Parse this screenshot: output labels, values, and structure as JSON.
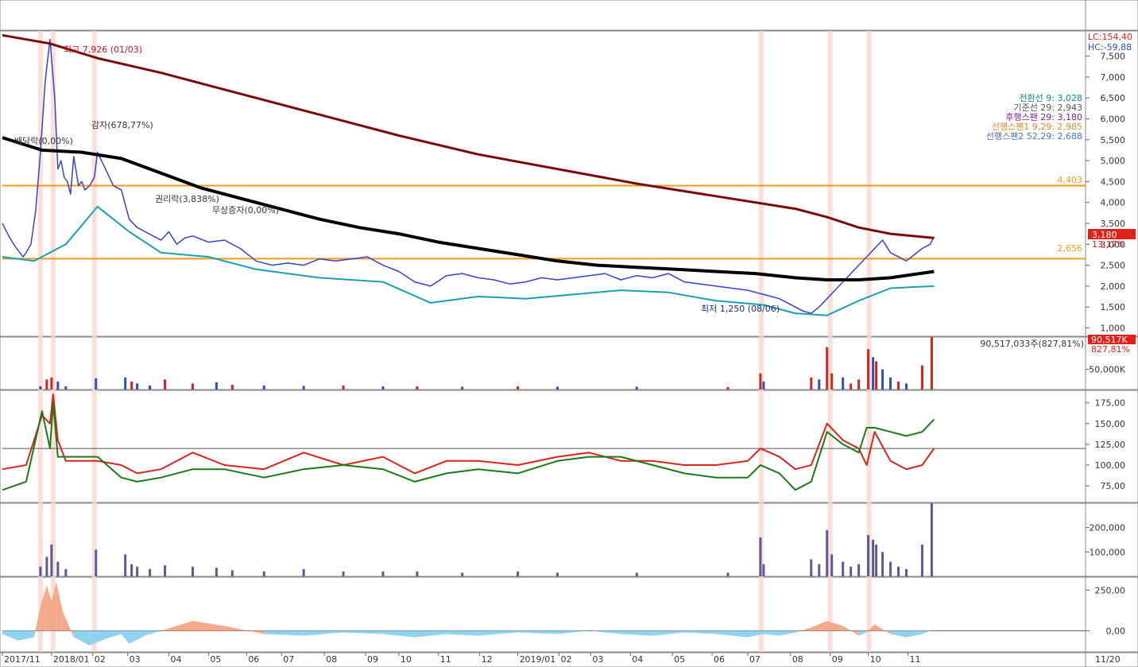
{
  "chart_data": [
    {
      "type": "line",
      "panel": "price",
      "ylim": [
        800,
        8100
      ],
      "yticks": [
        7500,
        7000,
        6500,
        6000,
        5500,
        5000,
        4500,
        4000,
        3500,
        3000,
        2500,
        2000,
        1500,
        1000
      ],
      "ytick_labels": [
        "7,500",
        "7,000",
        "6,500",
        "6,000",
        "5,500",
        "5,000",
        "4,500",
        "4,000",
        "3,500",
        "3,000",
        "2,500",
        "2,000",
        "1,500",
        "1,000"
      ],
      "corner_labels": {
        "lc": "LC:154,40",
        "hc": "HC:-59,88"
      },
      "legend": [
        {
          "text": "전환선 9: 3,028",
          "color": "#0c8a8a"
        },
        {
          "text": "기준선 29: 2,943",
          "color": "#555555"
        },
        {
          "text": "후행스팬 29: 3,180",
          "color": "#7a1f9e"
        },
        {
          "text": "선행스팬1 9,29: 2,985",
          "color": "#e28a2b"
        },
        {
          "text": "선행스팬2 52,29: 2,688",
          "color": "#4a6fd1"
        }
      ],
      "hlines": [
        {
          "value": 4403,
          "label": "4,403",
          "color": "#f59a1b"
        },
        {
          "value": 2656,
          "label": "2,656",
          "color": "#f59a1b"
        }
      ],
      "price_tag": {
        "value": 3180,
        "label": "3,180",
        "pct": "13,17%",
        "color": "#e0201b"
      },
      "annotations": [
        {
          "text": "최고 7,926 (01/03)",
          "color": "#c8102e"
        },
        {
          "text": "감자(678,77%)",
          "color": "#333333"
        },
        {
          "text": "배당락(0,00%)",
          "color": "#333333"
        },
        {
          "text": "권리락(3,838%)",
          "color": "#333333"
        },
        {
          "text": "무상증자(0,00%)",
          "color": "#333333"
        },
        {
          "text": "최저 1,250 (08/06)",
          "color": "#1a2a8a"
        }
      ],
      "series": [
        {
          "kind": "close",
          "color": "#3344cc",
          "x": [
            0,
            8,
            16,
            22,
            26,
            30,
            36,
            42,
            48,
            54,
            60,
            66,
            70,
            74,
            78,
            82,
            86,
            90,
            96,
            100,
            104,
            110,
            116,
            120,
            125,
            130,
            140,
            150,
            160,
            170,
            180,
            190,
            200,
            210,
            220,
            230,
            240,
            260,
            280,
            300,
            320,
            340,
            360,
            380,
            400,
            420,
            440,
            460,
            480,
            500,
            520,
            540,
            560,
            580,
            600,
            620,
            640,
            660,
            680,
            700,
            720,
            740,
            760,
            780,
            800,
            820,
            840,
            860,
            880,
            900,
            920,
            940,
            960,
            980,
            990,
            1000,
            1010,
            1020,
            1030,
            1040,
            1050,
            1060,
            1070,
            1080,
            1090,
            1100,
            1110,
            1120,
            1130,
            1140,
            1150,
            1160,
            1170,
            1175
          ],
          "y": [
            3500,
            3200,
            2950,
            2800,
            2700,
            2800,
            3000,
            3800,
            5200,
            6900,
            7900,
            6500,
            4800,
            5000,
            4600,
            4500,
            4200,
            5100,
            4400,
            4500,
            4300,
            4400,
            4600,
            5200,
            5000,
            4800,
            4400,
            4300,
            3600,
            3400,
            3300,
            3200,
            3100,
            3300,
            3000,
            3150,
            3200,
            3050,
            3100,
            2900,
            2600,
            2500,
            2550,
            2500,
            2650,
            2600,
            2650,
            2700,
            2500,
            2350,
            2100,
            2000,
            2250,
            2300,
            2200,
            2150,
            2050,
            2100,
            2200,
            2150,
            2200,
            2250,
            2300,
            2150,
            2250,
            2200,
            2300,
            2100,
            2050,
            2000,
            1950,
            1900,
            1800,
            1700,
            1600,
            1500,
            1400,
            1350,
            1500,
            1700,
            1900,
            2100,
            2300,
            2500,
            2700,
            2900,
            3100,
            2800,
            2700,
            2600,
            2750,
            2900,
            3000,
            3180
          ]
        },
        {
          "kind": "ma_long",
          "color": "#7a0a0a",
          "x": [
            0,
            60,
            120,
            200,
            300,
            400,
            500,
            600,
            700,
            800,
            900,
            1000,
            1040,
            1080,
            1120,
            1175
          ],
          "y": [
            8000,
            7800,
            7450,
            7100,
            6600,
            6100,
            5600,
            5150,
            4800,
            4450,
            4150,
            3850,
            3650,
            3400,
            3250,
            3150
          ]
        },
        {
          "kind": "ma_mid",
          "color": "#000000",
          "x": [
            0,
            50,
            100,
            150,
            200,
            250,
            300,
            350,
            400,
            450,
            500,
            550,
            600,
            650,
            700,
            750,
            800,
            850,
            900,
            950,
            1000,
            1040,
            1080,
            1120,
            1175
          ],
          "y": [
            5550,
            5250,
            5200,
            5050,
            4700,
            4350,
            4100,
            3850,
            3600,
            3400,
            3250,
            3050,
            2900,
            2750,
            2600,
            2500,
            2450,
            2400,
            2350,
            2300,
            2200,
            2150,
            2150,
            2200,
            2350
          ]
        },
        {
          "kind": "envelope_low",
          "color": "#1aa0b0",
          "x": [
            0,
            40,
            80,
            120,
            160,
            200,
            260,
            320,
            400,
            480,
            540,
            600,
            660,
            720,
            780,
            840,
            900,
            960,
            1000,
            1040,
            1080,
            1120,
            1175
          ],
          "y": [
            2700,
            2600,
            3000,
            3900,
            3300,
            2800,
            2700,
            2400,
            2200,
            2100,
            1600,
            1750,
            1700,
            1800,
            1900,
            1850,
            1650,
            1550,
            1350,
            1300,
            1650,
            1950,
            2000
          ]
        }
      ]
    },
    {
      "type": "bar",
      "panel": "volume",
      "ylim": [
        0,
        130000
      ],
      "ytick_labels": [
        "50,000K"
      ],
      "yticks": [
        50000
      ],
      "header": "90,517,033주(827,81%)",
      "tag": {
        "label": "90,517K",
        "pct": "827,81%"
      },
      "x": [
        48,
        56,
        62,
        70,
        80,
        118,
        155,
        163,
        170,
        186,
        205,
        240,
        270,
        290,
        330,
        380,
        430,
        480,
        523,
        580,
        650,
        700,
        800,
        915,
        956,
        960,
        1020,
        1030,
        1040,
        1046,
        1060,
        1070,
        1080,
        1092,
        1098,
        1102,
        1110,
        1120,
        1130,
        1140,
        1160,
        1172
      ],
      "values": [
        8000,
        25000,
        30000,
        20000,
        8000,
        28000,
        30000,
        20000,
        15000,
        10000,
        25000,
        15000,
        18000,
        12000,
        10000,
        9000,
        10000,
        8000,
        8000,
        7000,
        8000,
        7000,
        7000,
        6000,
        40000,
        20000,
        30000,
        25000,
        105000,
        40000,
        30000,
        15000,
        25000,
        100000,
        80000,
        70000,
        50000,
        30000,
        20000,
        15000,
        60000,
        130000
      ],
      "colors": [
        "#2a4fc8",
        "#d9231b",
        "#d9231b",
        "#2a4fc8",
        "#2a4fc8",
        "#2a4fc8",
        "#2a4fc8",
        "#d9231b",
        "#2a4fc8",
        "#2a4fc8",
        "#d9231b",
        "#d9231b",
        "#2a4fc8",
        "#d9231b",
        "#2a4fc8",
        "#2a4fc8",
        "#d9231b",
        "#2a4fc8",
        "#d9231b",
        "#2a4fc8",
        "#d9231b",
        "#2a4fc8",
        "#2a4fc8",
        "#d9231b",
        "#d9231b",
        "#2a4fc8",
        "#d9231b",
        "#2a4fc8",
        "#d9231b",
        "#d9231b",
        "#2a4fc8",
        "#d9231b",
        "#d9231b",
        "#d9231b",
        "#2a4fc8",
        "#d9231b",
        "#2a4fc8",
        "#2a4fc8",
        "#d9231b",
        "#2a4fc8",
        "#d9231b",
        "#d9231b"
      ]
    },
    {
      "type": "line",
      "panel": "oscillator",
      "ylim": [
        55,
        190
      ],
      "yticks": [
        175,
        150,
        125,
        100,
        75
      ],
      "ytick_labels": [
        "175,00",
        "150,00",
        "125,00",
        "100,00",
        "75,00"
      ],
      "baseline": 120,
      "series": [
        {
          "color": "#d9231b",
          "x": [
            0,
            30,
            50,
            60,
            64,
            70,
            80,
            100,
            120,
            150,
            170,
            200,
            240,
            280,
            330,
            380,
            430,
            480,
            520,
            560,
            600,
            650,
            700,
            740,
            780,
            820,
            860,
            900,
            940,
            956,
            980,
            1000,
            1020,
            1040,
            1060,
            1080,
            1090,
            1100,
            1120,
            1140,
            1160,
            1175
          ],
          "y": [
            95,
            100,
            160,
            150,
            185,
            130,
            105,
            105,
            105,
            100,
            90,
            95,
            115,
            100,
            95,
            115,
            100,
            110,
            90,
            105,
            105,
            100,
            110,
            115,
            105,
            105,
            100,
            100,
            105,
            120,
            110,
            95,
            100,
            150,
            130,
            120,
            100,
            140,
            105,
            95,
            100,
            120
          ]
        },
        {
          "color": "#1a7a1a",
          "x": [
            0,
            30,
            50,
            60,
            64,
            70,
            80,
            100,
            120,
            150,
            170,
            200,
            240,
            280,
            330,
            380,
            430,
            480,
            520,
            560,
            600,
            650,
            700,
            740,
            780,
            820,
            860,
            900,
            940,
            956,
            980,
            1000,
            1020,
            1040,
            1060,
            1080,
            1090,
            1100,
            1120,
            1140,
            1160,
            1175
          ],
          "y": [
            70,
            80,
            165,
            120,
            175,
            110,
            110,
            110,
            110,
            85,
            80,
            85,
            95,
            95,
            85,
            95,
            100,
            95,
            80,
            90,
            95,
            90,
            105,
            110,
            110,
            100,
            90,
            85,
            85,
            100,
            90,
            70,
            80,
            140,
            125,
            115,
            145,
            145,
            140,
            135,
            140,
            155
          ]
        }
      ]
    },
    {
      "type": "bar",
      "panel": "histogram",
      "ylim": [
        0,
        300000
      ],
      "yticks": [
        200000,
        100000
      ],
      "ytick_labels": [
        "200,000",
        "100,000"
      ],
      "color": "#5a5a9a",
      "x": [
        48,
        56,
        62,
        70,
        80,
        118,
        155,
        163,
        170,
        186,
        205,
        240,
        270,
        290,
        330,
        380,
        430,
        480,
        523,
        580,
        650,
        700,
        800,
        915,
        956,
        960,
        1020,
        1030,
        1040,
        1046,
        1060,
        1070,
        1080,
        1092,
        1098,
        1102,
        1110,
        1120,
        1130,
        1140,
        1160,
        1172
      ],
      "values": [
        40000,
        80000,
        130000,
        60000,
        30000,
        110000,
        90000,
        50000,
        40000,
        30000,
        45000,
        40000,
        35000,
        25000,
        20000,
        30000,
        20000,
        20000,
        20000,
        15000,
        20000,
        15000,
        15000,
        15000,
        160000,
        50000,
        70000,
        50000,
        190000,
        90000,
        60000,
        40000,
        50000,
        170000,
        150000,
        130000,
        100000,
        60000,
        40000,
        30000,
        130000,
        300000
      ]
    },
    {
      "type": "area",
      "panel": "macd",
      "ylim": [
        -130,
        330
      ],
      "yticks": [
        250,
        0
      ],
      "ytick_labels": [
        "250,00",
        "0,00"
      ],
      "pos_color": "#f3a98a",
      "neg_color": "#8fd3ee",
      "x": [
        0,
        20,
        40,
        48,
        56,
        62,
        68,
        76,
        90,
        110,
        130,
        150,
        160,
        180,
        200,
        240,
        280,
        330,
        380,
        430,
        480,
        520,
        560,
        600,
        650,
        700,
        740,
        780,
        820,
        860,
        900,
        940,
        960,
        980,
        1000,
        1020,
        1040,
        1060,
        1080,
        1090,
        1100,
        1120,
        1140,
        1160,
        1175
      ],
      "values": [
        -20,
        -60,
        -40,
        150,
        280,
        180,
        300,
        120,
        -40,
        -90,
        -50,
        -20,
        -80,
        -30,
        0,
        60,
        30,
        -20,
        -30,
        -10,
        -20,
        -40,
        -20,
        -30,
        -10,
        -20,
        0,
        -20,
        -30,
        -10,
        -20,
        -40,
        -20,
        -30,
        -10,
        20,
        60,
        30,
        -30,
        -10,
        40,
        -20,
        -40,
        -20,
        10
      ]
    },
    {
      "type": "axis",
      "panel": "x-axis",
      "xticks": [
        {
          "x": 0,
          "label": "2017/11"
        },
        {
          "x": 62,
          "label": "2018/01"
        },
        {
          "x": 114,
          "label": "02"
        },
        {
          "x": 158,
          "label": "03"
        },
        {
          "x": 210,
          "label": "04"
        },
        {
          "x": 260,
          "label": "05"
        },
        {
          "x": 308,
          "label": "06"
        },
        {
          "x": 352,
          "label": "07"
        },
        {
          "x": 406,
          "label": "08"
        },
        {
          "x": 458,
          "label": "09"
        },
        {
          "x": 500,
          "label": "10"
        },
        {
          "x": 550,
          "label": "11"
        },
        {
          "x": 602,
          "label": "12"
        },
        {
          "x": 650,
          "label": "2019/01"
        },
        {
          "x": 702,
          "label": "02"
        },
        {
          "x": 742,
          "label": "03"
        },
        {
          "x": 792,
          "label": "04"
        },
        {
          "x": 845,
          "label": "05"
        },
        {
          "x": 895,
          "label": "06"
        },
        {
          "x": 940,
          "label": "07"
        },
        {
          "x": 994,
          "label": "08"
        },
        {
          "x": 1044,
          "label": "09"
        },
        {
          "x": 1092,
          "label": "10"
        },
        {
          "x": 1142,
          "label": "11"
        }
      ],
      "right_label": "11/20",
      "event_x": [
        48,
        64,
        116,
        957,
        1044,
        1093
      ]
    }
  ]
}
